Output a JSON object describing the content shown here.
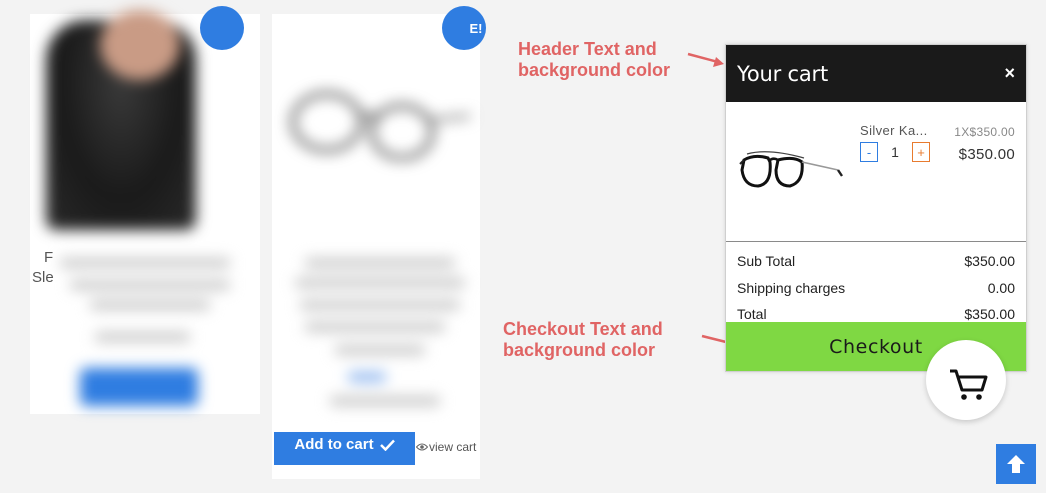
{
  "background": {
    "card2_button_label": "Add to cart",
    "view_cart_label": "view cart",
    "card1_text_fragments": [
      "F",
      "Sle"
    ],
    "badge2_text": "E!",
    "icons": {
      "check": "check-icon",
      "eye": "eye-icon"
    }
  },
  "annotations": {
    "header_note": [
      "Header Text and",
      "background color"
    ],
    "checkout_note": [
      "Checkout Text and",
      "background color"
    ],
    "color": "#e06464"
  },
  "cart": {
    "title": "Your cart",
    "close_symbol": "×",
    "item": {
      "name": "Silver Ka...",
      "unit_price": "1X$350.00",
      "price": "$350.00",
      "quantity": "1",
      "minus": "-",
      "plus": "+",
      "image_icon": "eyeglasses-image"
    },
    "totals": [
      {
        "label": "Sub Total",
        "value": "$350.00"
      },
      {
        "label": "Shipping charges",
        "value": "0.00"
      },
      {
        "label": "Total",
        "value": "$350.00"
      }
    ],
    "checkout_label": "Checkout",
    "colors": {
      "header_bg": "#1a1a1a",
      "header_text": "#ffffff",
      "checkout_bg": "#7fd843",
      "checkout_text": "#1a1a1a"
    }
  },
  "floating": {
    "cart_icon": "shopping-cart-icon",
    "scroll_top_icon": "arrow-up-icon",
    "accent": "#2f7de1"
  }
}
